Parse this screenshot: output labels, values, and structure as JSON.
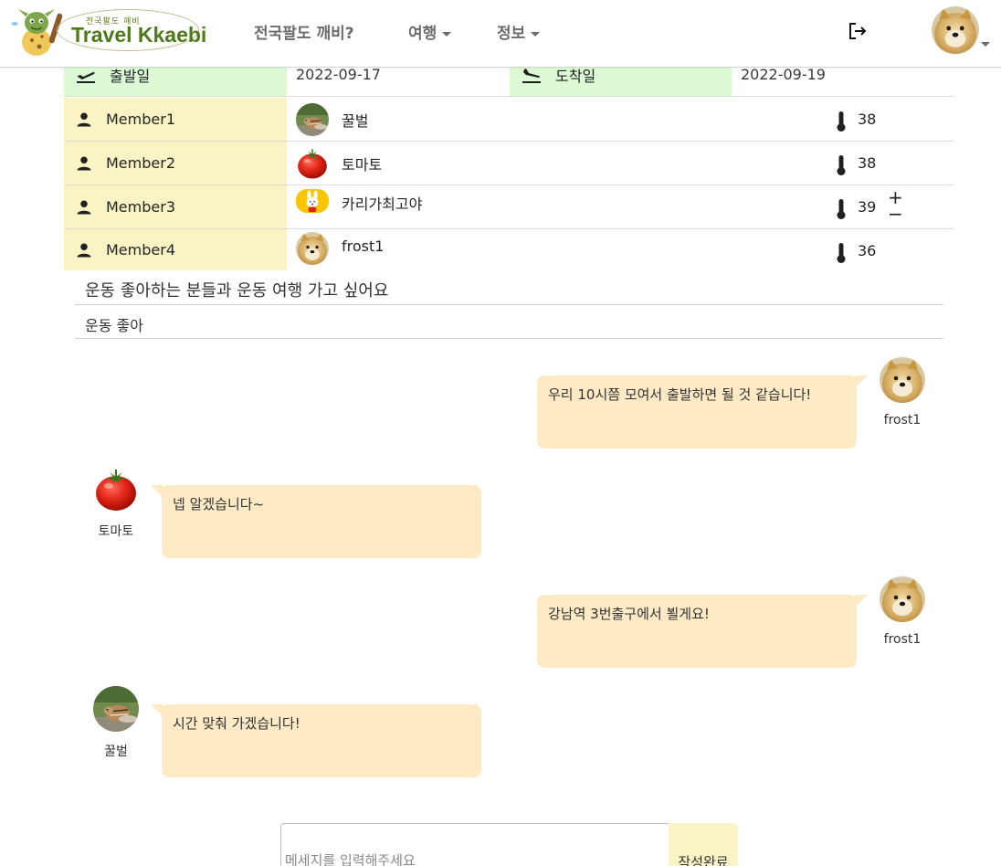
{
  "nav": {
    "logo_small": "전국팔도 깨비",
    "logo_text": "Travel Kkaebi",
    "links": [
      {
        "label": "전국팔도 깨비?"
      },
      {
        "label": "여행"
      },
      {
        "label": "정보"
      }
    ]
  },
  "trip": {
    "departure_label": "출발일",
    "departure_date": "2022-09-17",
    "arrival_label": "도착일",
    "arrival_date": "2022-09-19"
  },
  "members": [
    {
      "label": "Member1",
      "name": "꿀벌",
      "temp": "38",
      "avatar": "chipmunk"
    },
    {
      "label": "Member2",
      "name": "토마토",
      "temp": "38",
      "avatar": "tomato"
    },
    {
      "label": "Member3",
      "name": "카리가최고야",
      "temp": "39",
      "avatar": "bunny"
    },
    {
      "label": "Member4",
      "name": "frost1",
      "temp": "36",
      "avatar": "doge"
    }
  ],
  "temp_controls": {
    "plus": "+",
    "minus": "−"
  },
  "intro": {
    "title": "운동 좋아하는 분들과 운동 여행 가고 싶어요",
    "text": "운동 좋아"
  },
  "chat": [
    {
      "side": "right",
      "name": "frost1",
      "avatar": "doge",
      "text": "우리 10시쯤 모여서 출발하면 될 것 같습니다!"
    },
    {
      "side": "left",
      "name": "토마토",
      "avatar": "tomato",
      "text": "넵 알겠습니다~"
    },
    {
      "side": "right",
      "name": "frost1",
      "avatar": "doge",
      "text": "강남역 3번출구에서 뵐게요!"
    },
    {
      "side": "left",
      "name": "꿀벌",
      "avatar": "chipmunk",
      "text": "시간 맞춰 가겠습니다!"
    }
  ],
  "composer": {
    "placeholder": "메세지를 입력해주세요",
    "send_label": "작성완료"
  },
  "colors": {
    "green_cell": "#dcfbd5",
    "yellow_cell": "#faf4c4",
    "bubble": "#ffeac6",
    "brand": "#4e7a1b"
  }
}
